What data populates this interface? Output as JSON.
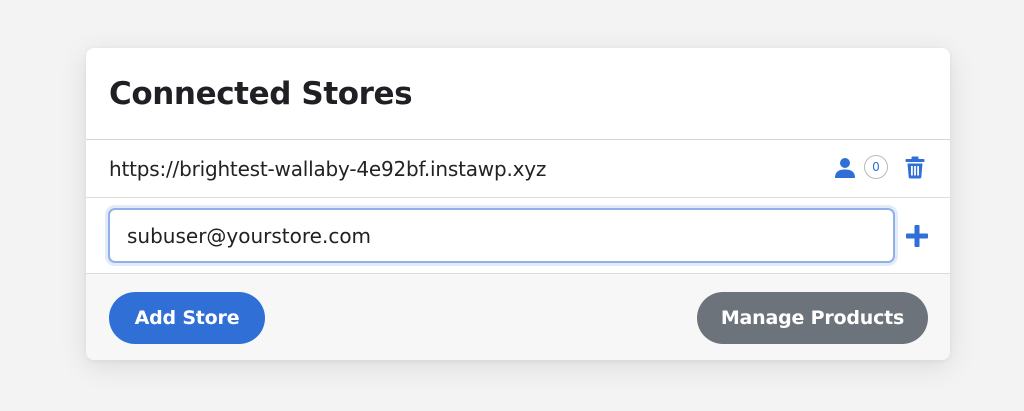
{
  "panel": {
    "title": "Connected Stores"
  },
  "stores": [
    {
      "url": "https://brightest-wallaby-4e92bf.instawp.xyz",
      "user_count": "0"
    }
  ],
  "add_user": {
    "email_value": "subuser@yourstore.com"
  },
  "footer": {
    "add_store_label": "Add Store",
    "manage_products_label": "Manage Products"
  },
  "icons": {
    "user": "user-icon",
    "trash": "trash-icon",
    "plus": "plus-icon"
  },
  "colors": {
    "accent": "#2f6fd6",
    "secondary_button": "#6c737a",
    "input_focus_border": "#8fb0e8",
    "background": "#f3f3f3"
  }
}
